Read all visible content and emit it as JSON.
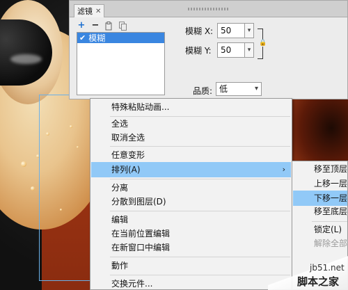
{
  "panel": {
    "tab_label": "滤镜",
    "close_glyph": "✕",
    "filters": [
      {
        "name": "模糊",
        "enabled": true
      }
    ],
    "blur_x_label": "模糊 X:",
    "blur_x_value": "50",
    "blur_y_label": "模糊 Y:",
    "blur_y_value": "50",
    "quality_label": "品质:",
    "quality_value": "低"
  },
  "context_menu": {
    "items": [
      {
        "label": "特殊粘贴动画..."
      },
      {
        "label": "全选"
      },
      {
        "label": "取消全选"
      },
      {
        "label": "任意变形"
      },
      {
        "label": "排列(A)",
        "submenu": true,
        "highlighted": true
      },
      {
        "label": "分离"
      },
      {
        "label": "分散到图层(D)"
      },
      {
        "label": "编辑"
      },
      {
        "label": "在当前位置编辑"
      },
      {
        "label": "在新窗口中编辑"
      },
      {
        "label": "動作"
      },
      {
        "label": "交换元件..."
      }
    ]
  },
  "submenu": {
    "items": [
      {
        "label": "移至顶层"
      },
      {
        "label": "上移一层"
      },
      {
        "label": "下移一层",
        "highlighted": true
      },
      {
        "label": "移至底层"
      },
      {
        "label": "锁定(L)"
      },
      {
        "label": "解除全部"
      }
    ]
  },
  "watermark": {
    "line1": "jb51.net",
    "line2": "脚本之家"
  },
  "colors": {
    "highlight": "#91c9f7",
    "filter_selected": "#3a86e0",
    "panel_bg": "#ececec",
    "menu_bg": "#f2f2f2"
  }
}
